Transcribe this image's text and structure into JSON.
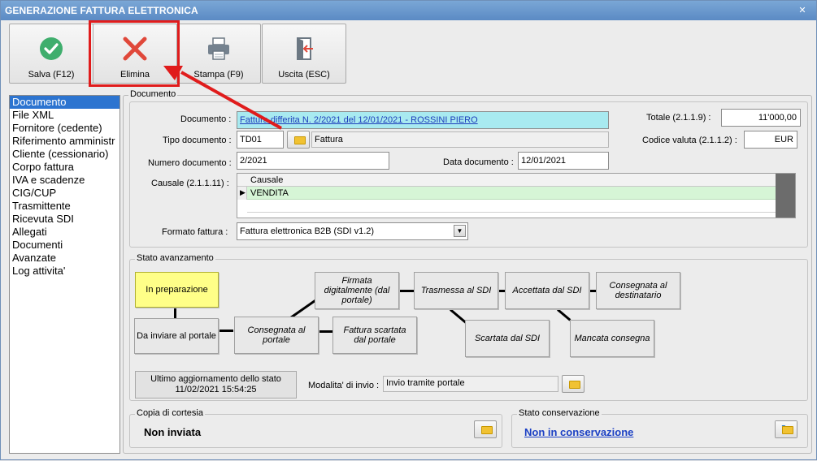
{
  "window": {
    "title": "GENERAZIONE FATTURA ELETTRONICA",
    "close": "✕"
  },
  "toolbar": {
    "save_label": "Salva (F12)",
    "delete_label": "Elimina",
    "print_label": "Stampa (F9)",
    "exit_label": "Uscita (ESC)"
  },
  "sidebar": {
    "items": [
      {
        "label": "Documento"
      },
      {
        "label": "File XML"
      },
      {
        "label": "Fornitore (cedente)"
      },
      {
        "label": "Riferimento amministr"
      },
      {
        "label": "Cliente (cessionario)"
      },
      {
        "label": "Corpo fattura"
      },
      {
        "label": "IVA e scadenze"
      },
      {
        "label": "CIG/CUP"
      },
      {
        "label": "Trasmittente"
      },
      {
        "label": "Ricevuta SDI"
      },
      {
        "label": "Allegati"
      },
      {
        "label": "Documenti"
      },
      {
        "label": "Avanzate"
      },
      {
        "label": "Log attivita'"
      }
    ]
  },
  "documento": {
    "group_title": "Documento",
    "documento_label": "Documento :",
    "documento_value": "Fattura differita N. 2/2021 del 12/01/2021 - ROSSINI PIERO",
    "totale_label": "Totale (2.1.1.9) :",
    "totale_value": "11'000,00",
    "tipo_label": "Tipo documento :",
    "tipo_code": "TD01",
    "tipo_desc": "Fattura",
    "valuta_label": "Codice valuta (2.1.1.2) :",
    "valuta_value": "EUR",
    "numero_label": "Numero documento :",
    "numero_value": "2/2021",
    "data_label": "Data documento :",
    "data_value": "12/01/2021",
    "causale_label": "Causale (2.1.1.11) :",
    "causale_header": "Causale",
    "causale_row": "VENDITA",
    "formato_label": "Formato fattura :",
    "formato_value": "Fattura elettronica B2B (SDI v1.2)"
  },
  "stato": {
    "group_title": "Stato avanzamento",
    "in_preparazione": "In preparazione",
    "da_inviare": "Da inviare al portale",
    "consegnata_portale": "Consegnata al portale",
    "firmata": "Firmata digitalmente (dal portale)",
    "scartata_portale": "Fattura scartata dal portale",
    "trasmessa": "Trasmessa al SDI",
    "scartata_sdi": "Scartata dal SDI",
    "accettata": "Accettata dal SDI",
    "mancata": "Mancata consegna",
    "consegnata_dest": "Consegnata al destinatario",
    "ultimo_label": "Ultimo aggiornamento dello stato",
    "ultimo_value": "11/02/2021 15:54:25",
    "modalita_label": "Modalita' di invio :",
    "modalita_value": "Invio tramite portale"
  },
  "copia": {
    "group_title": "Copia di cortesia",
    "value": "Non inviata"
  },
  "conservazione": {
    "group_title": "Stato conservazione",
    "value": "Non in conservazione"
  }
}
